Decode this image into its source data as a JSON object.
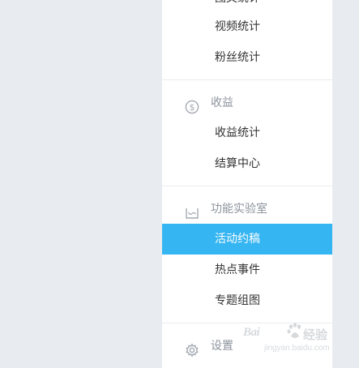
{
  "sidebar": {
    "cut_item": "图文统计",
    "groups": [
      {
        "items": [
          "视频统计",
          "粉丝统计"
        ]
      },
      {
        "title": "收益",
        "icon": "dollar-circle-icon",
        "items": [
          "收益统计",
          "结算中心"
        ]
      },
      {
        "title": "功能实验室",
        "icon": "lab-tray-icon",
        "items": [
          "活动约稿",
          "热点事件",
          "专题组图"
        ]
      },
      {
        "title": "设置",
        "icon": "gear-icon",
        "items": []
      }
    ],
    "active_item": "活动约稿"
  },
  "colors": {
    "accent": "#35b5f2",
    "background": "#e8ebef",
    "section_text": "#8c939d",
    "item_text": "#333333"
  },
  "watermark": {
    "brand": "Bai",
    "brand_suffix": "经验",
    "url": "jingyan.baidu.com"
  }
}
